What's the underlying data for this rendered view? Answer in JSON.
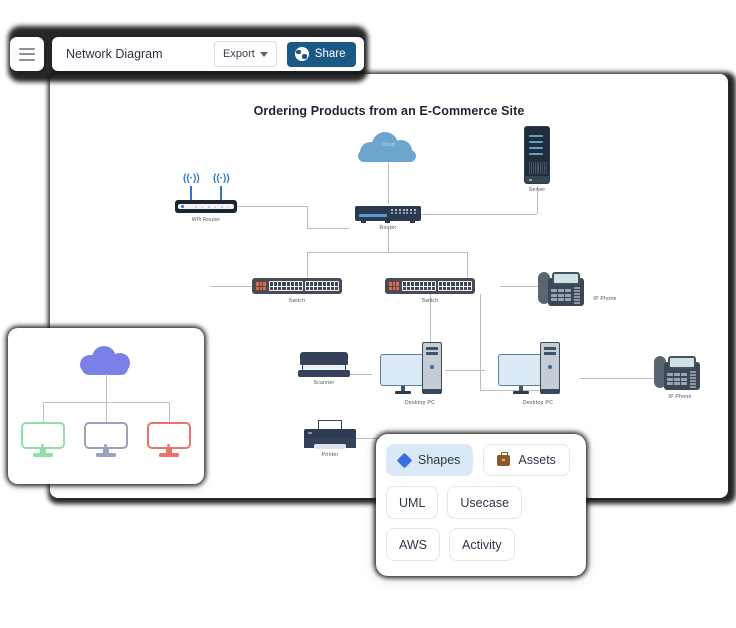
{
  "topbar": {
    "menu_icon": "hamburger-menu-icon",
    "doc_title": "Network Diagram",
    "export_label": "Export",
    "share_label": "Share",
    "share_icon": "globe-icon",
    "share_color": "#1b5886"
  },
  "canvas": {
    "title": "Ordering Products from an E-Commerce Site"
  },
  "diagram": {
    "nodes": [
      {
        "id": "wifi-router",
        "label": "Wifi  Router",
        "icon": "wifi-router-icon"
      },
      {
        "id": "cloud",
        "label": "Cloud",
        "icon": "cloud-icon",
        "color": "#6CA6CE"
      },
      {
        "id": "router",
        "label": "Router",
        "icon": "router-icon"
      },
      {
        "id": "server",
        "label": "Server",
        "icon": "server-icon"
      },
      {
        "id": "switch-left",
        "label": "Switch",
        "icon": "switch-icon"
      },
      {
        "id": "switch-right",
        "label": "Switch",
        "icon": "switch-icon"
      },
      {
        "id": "ip-phone-top",
        "label": "IP  Phone",
        "icon": "ip-phone-icon"
      },
      {
        "id": "scanner",
        "label": "Scanner",
        "icon": "scanner-icon"
      },
      {
        "id": "desktop-pc-left",
        "label": "Desktop   PC",
        "icon": "desktop-pc-icon"
      },
      {
        "id": "desktop-pc-right",
        "label": "Desktop   PC",
        "icon": "desktop-pc-icon"
      },
      {
        "id": "ip-phone-bottom",
        "label": "IP  Phone",
        "icon": "ip-phone-icon"
      },
      {
        "id": "printer",
        "label": "Printer",
        "icon": "printer-icon"
      }
    ]
  },
  "inset": {
    "cloud_color": "#7B7FE8",
    "monitors": [
      {
        "id": "monitor-green",
        "color": "#8FE0A8"
      },
      {
        "id": "monitor-slate",
        "color": "#9AA2BE"
      },
      {
        "id": "monitor-red",
        "color": "#E8736B"
      }
    ]
  },
  "shapes_panel": {
    "tabs": [
      {
        "id": "shapes",
        "label": "Shapes",
        "icon": "diamond-icon",
        "active": true
      },
      {
        "id": "assets",
        "label": "Assets",
        "icon": "briefcase-icon",
        "active": false
      }
    ],
    "buttons": [
      {
        "id": "uml",
        "label": "UML"
      },
      {
        "id": "usecase",
        "label": "Usecase"
      },
      {
        "id": "aws",
        "label": "AWS"
      },
      {
        "id": "activity",
        "label": "Activity"
      }
    ]
  }
}
